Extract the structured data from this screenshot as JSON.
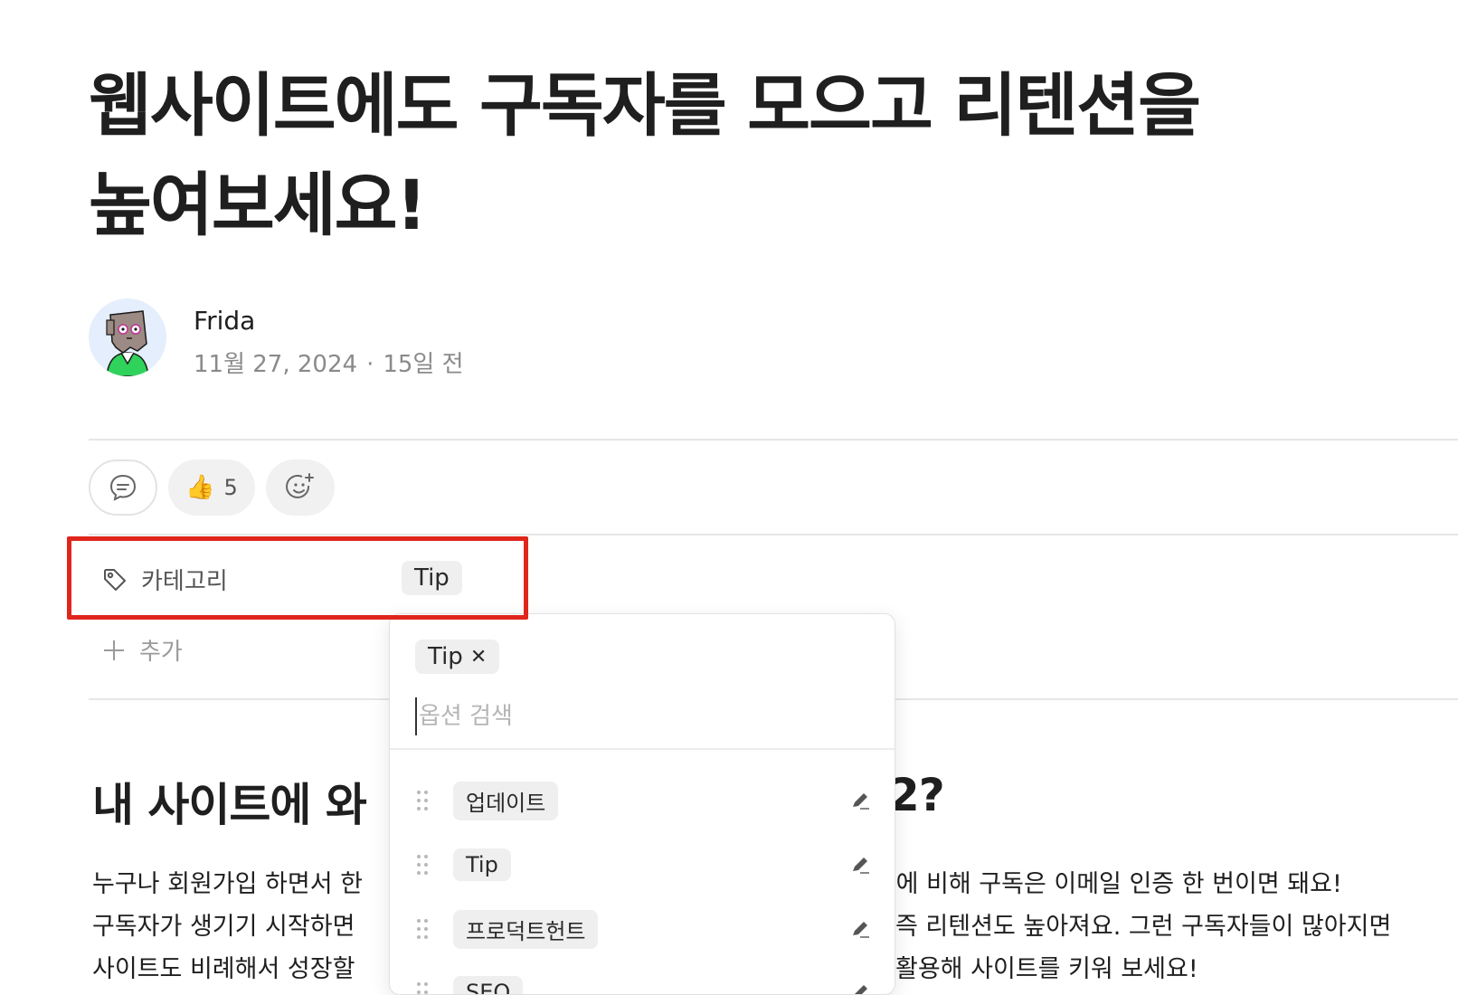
{
  "post": {
    "title_line1": "웹사이트에도 구독자를 모으고 리텐션을",
    "title_line2": "높여보세요!",
    "author": "Frida",
    "date": "11월 27, 2024",
    "relative_date": "15일 전"
  },
  "reactions": {
    "like_count": "5",
    "like_emoji": "👍"
  },
  "properties": {
    "category_label": "카테고리",
    "category_value": "Tip",
    "add_label": "추가"
  },
  "dropdown": {
    "selected_tag": "Tip",
    "remove_glyph": "✕",
    "search_placeholder": "옵션 검색",
    "options": [
      {
        "label": "업데이트"
      },
      {
        "label": "Tip"
      },
      {
        "label": "프로덕트헌트"
      },
      {
        "label": "SEO"
      }
    ]
  },
  "content": {
    "heading_left": "내 사이트에 와",
    "heading_right": "2?",
    "para_lines": [
      {
        "left": "누구나 회원가입 하면서 한",
        "right": ".에 비해 구독은 이메일 인증 한 번이면 돼요!"
      },
      {
        "left": "구독자가 생기기 시작하면",
        "right": "즉 리텐션도 높아져요. 그런 구독자들이 많아지면"
      },
      {
        "left": "사이트도 비례해서 성장할",
        "right": "활용해 사이트를 키워 보세요!"
      }
    ]
  },
  "icons": {
    "comment": "comment-icon",
    "add_reaction": "add-reaction-icon",
    "tag": "tag-icon",
    "plus": "plus-icon",
    "grip": "drag-handle-icon",
    "edit": "edit-icon"
  },
  "colors": {
    "highlight": "#e0261c",
    "tag_bg": "#efefef"
  }
}
